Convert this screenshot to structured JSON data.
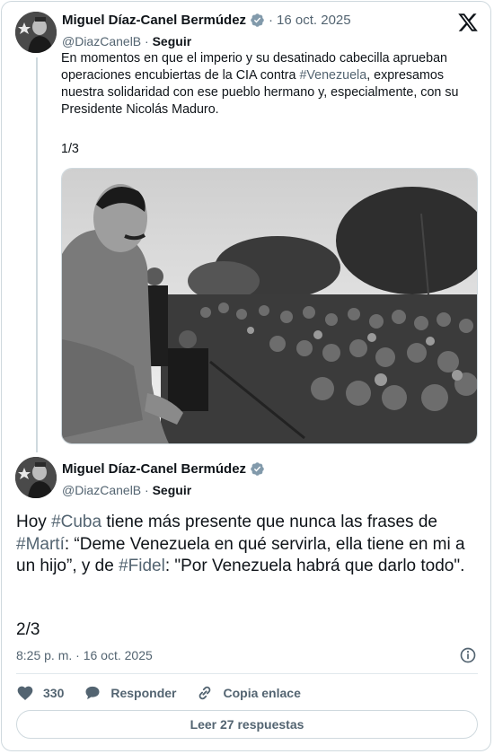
{
  "tweet1": {
    "author_name": "Miguel Díaz-Canel Bermúdez",
    "date": "16 oct. 2025",
    "handle": "@DiazCanelB",
    "follow_label": "Seguir",
    "text_part1": "En momentos en que el imperio y su desatinado cabecilla aprueban operaciones encubiertas de la CIA contra ",
    "hashtag": "#Venezuela",
    "text_part2": ", expresamos nuestra solidaridad con ese pueblo hermano y, especialmente, con su Presidente Nicolás Maduro.",
    "counter": "1/3"
  },
  "tweet2": {
    "author_name": "Miguel Díaz-Canel Bermúdez",
    "handle": "@DiazCanelB",
    "follow_label": "Seguir",
    "text_seg1": "Hoy ",
    "hashtag1": "#Cuba",
    "text_seg2": " tiene más presente que nunca las frases de ",
    "hashtag2": "#Martí",
    "text_seg3": ": “Deme Venezuela en qué servirla, ella tiene en mi a un hijo”, y de ",
    "hashtag3": "#Fidel",
    "text_seg4": ": \"Por Venezuela habrá que darlo todo\".",
    "counter": "2/3",
    "time": "8:25 p. m.",
    "date": "16 oct. 2025"
  },
  "actions": {
    "likes": "330",
    "reply_label": "Responder",
    "copy_label": "Copia enlace",
    "read_replies_label": "Leer 27 respuestas"
  },
  "colors": {
    "hashtag_blue": "#1d9bf0",
    "muted_text": "#536471",
    "verified_grey": "#829aab"
  }
}
